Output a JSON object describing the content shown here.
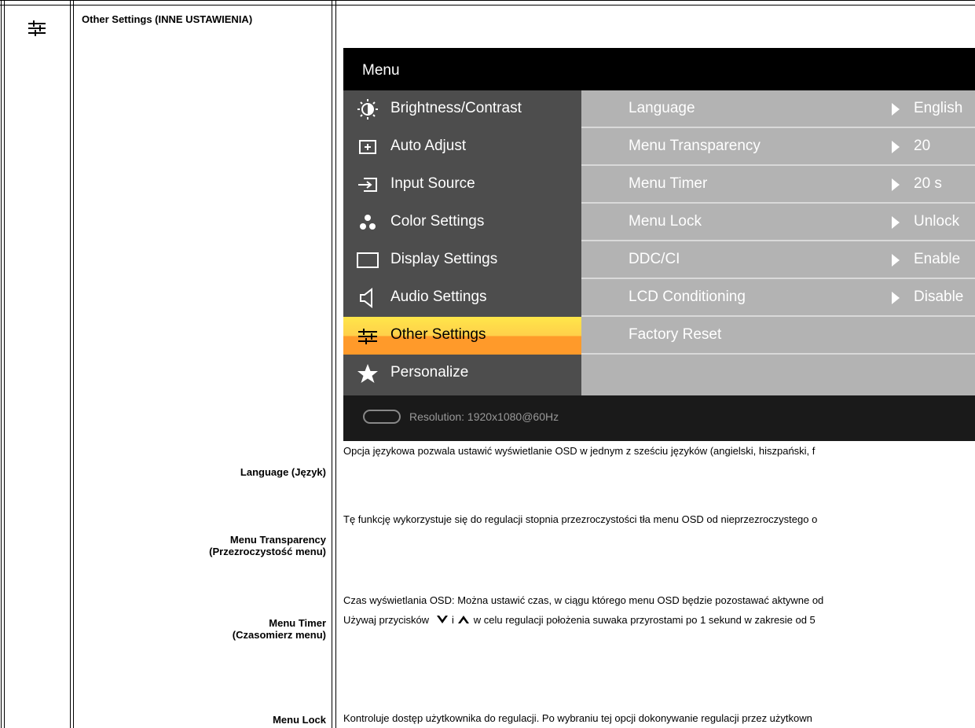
{
  "section": {
    "icon": "sliders-icon",
    "title": "Other Settings (INNE USTAWIENIA)"
  },
  "osd": {
    "title": "Menu",
    "left_items": [
      {
        "icon": "brightness-icon",
        "label": "Brightness/Contrast"
      },
      {
        "icon": "auto-adjust-icon",
        "label": "Auto Adjust"
      },
      {
        "icon": "input-source-icon",
        "label": "Input Source"
      },
      {
        "icon": "color-settings-icon",
        "label": "Color Settings"
      },
      {
        "icon": "display-settings-icon",
        "label": "Display Settings"
      },
      {
        "icon": "audio-settings-icon",
        "label": "Audio Settings"
      },
      {
        "icon": "sliders-icon",
        "label": "Other Settings",
        "selected": true
      },
      {
        "icon": "star-icon",
        "label": "Personalize"
      }
    ],
    "right_items": [
      {
        "label": "Language",
        "value": "English"
      },
      {
        "label": "Menu Transparency",
        "value": "20"
      },
      {
        "label": "Menu Timer",
        "value": "20 s"
      },
      {
        "label": "Menu Lock",
        "value": "Unlock"
      },
      {
        "label": "DDC/CI",
        "value": "Enable"
      },
      {
        "label": "LCD Conditioning",
        "value": "Disable"
      },
      {
        "label": "Factory Reset",
        "value": ""
      }
    ],
    "footer": {
      "icon": "vga-connector-icon",
      "text": "Resolution: 1920x1080@60Hz"
    },
    "colors": {
      "selected_top": "#ffe64a",
      "selected_bottom": "#ff9a2a",
      "left_bg": "#4d4d4d",
      "right_bg": "#b3b3b3"
    }
  },
  "rows": [
    {
      "label_line1": "Language (Język)",
      "text_lines": [
        "Opcja językowa pozwala ustawić wyświetlanie OSD w jednym z sześciu języków (angielski, hiszpański, f"
      ]
    },
    {
      "label_line1": "Menu Transparency",
      "label_line2": "(Przezroczystość menu)",
      "text_lines": [
        "Tę funkcję wykorzystuje się do regulacji stopnia przezroczystości tła menu OSD od nieprzezroczystego o"
      ]
    },
    {
      "label_line1": "Menu Timer",
      "label_line2": "(Czasomierz menu)",
      "text_lines": [
        "Czas wyświetlania OSD: Można ustawić czas, w ciągu którego menu OSD będzie pozostawać aktywne od",
        "Używaj przycisków",
        "i",
        "w celu regulacji położenia suwaka przyrostami po 1 sekund w zakresie od 5"
      ]
    },
    {
      "label_line1": "Menu Lock",
      "text_lines": [
        "Kontroluje dostęp użytkownika do regulacji. Po wybraniu tej opcji dokonywanie regulacji przez użytkown"
      ]
    }
  ]
}
